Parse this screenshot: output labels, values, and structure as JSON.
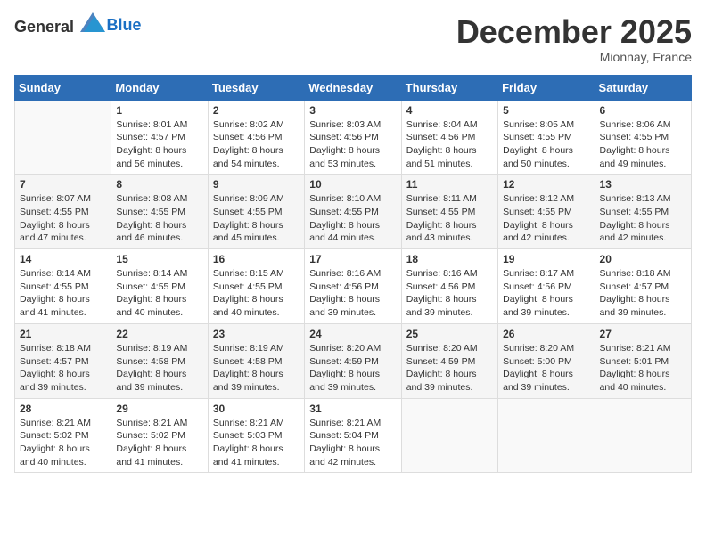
{
  "header": {
    "logo_general": "General",
    "logo_blue": "Blue",
    "month_year": "December 2025",
    "location": "Mionnay, France"
  },
  "days_of_week": [
    "Sunday",
    "Monday",
    "Tuesday",
    "Wednesday",
    "Thursday",
    "Friday",
    "Saturday"
  ],
  "weeks": [
    [
      {
        "day": null
      },
      {
        "day": 1,
        "sunrise": "8:01 AM",
        "sunset": "4:57 PM",
        "daylight": "8 hours and 56 minutes."
      },
      {
        "day": 2,
        "sunrise": "8:02 AM",
        "sunset": "4:56 PM",
        "daylight": "8 hours and 54 minutes."
      },
      {
        "day": 3,
        "sunrise": "8:03 AM",
        "sunset": "4:56 PM",
        "daylight": "8 hours and 53 minutes."
      },
      {
        "day": 4,
        "sunrise": "8:04 AM",
        "sunset": "4:56 PM",
        "daylight": "8 hours and 51 minutes."
      },
      {
        "day": 5,
        "sunrise": "8:05 AM",
        "sunset": "4:55 PM",
        "daylight": "8 hours and 50 minutes."
      },
      {
        "day": 6,
        "sunrise": "8:06 AM",
        "sunset": "4:55 PM",
        "daylight": "8 hours and 49 minutes."
      }
    ],
    [
      {
        "day": 7,
        "sunrise": "8:07 AM",
        "sunset": "4:55 PM",
        "daylight": "8 hours and 47 minutes."
      },
      {
        "day": 8,
        "sunrise": "8:08 AM",
        "sunset": "4:55 PM",
        "daylight": "8 hours and 46 minutes."
      },
      {
        "day": 9,
        "sunrise": "8:09 AM",
        "sunset": "4:55 PM",
        "daylight": "8 hours and 45 minutes."
      },
      {
        "day": 10,
        "sunrise": "8:10 AM",
        "sunset": "4:55 PM",
        "daylight": "8 hours and 44 minutes."
      },
      {
        "day": 11,
        "sunrise": "8:11 AM",
        "sunset": "4:55 PM",
        "daylight": "8 hours and 43 minutes."
      },
      {
        "day": 12,
        "sunrise": "8:12 AM",
        "sunset": "4:55 PM",
        "daylight": "8 hours and 42 minutes."
      },
      {
        "day": 13,
        "sunrise": "8:13 AM",
        "sunset": "4:55 PM",
        "daylight": "8 hours and 42 minutes."
      }
    ],
    [
      {
        "day": 14,
        "sunrise": "8:14 AM",
        "sunset": "4:55 PM",
        "daylight": "8 hours and 41 minutes."
      },
      {
        "day": 15,
        "sunrise": "8:14 AM",
        "sunset": "4:55 PM",
        "daylight": "8 hours and 40 minutes."
      },
      {
        "day": 16,
        "sunrise": "8:15 AM",
        "sunset": "4:55 PM",
        "daylight": "8 hours and 40 minutes."
      },
      {
        "day": 17,
        "sunrise": "8:16 AM",
        "sunset": "4:56 PM",
        "daylight": "8 hours and 39 minutes."
      },
      {
        "day": 18,
        "sunrise": "8:16 AM",
        "sunset": "4:56 PM",
        "daylight": "8 hours and 39 minutes."
      },
      {
        "day": 19,
        "sunrise": "8:17 AM",
        "sunset": "4:56 PM",
        "daylight": "8 hours and 39 minutes."
      },
      {
        "day": 20,
        "sunrise": "8:18 AM",
        "sunset": "4:57 PM",
        "daylight": "8 hours and 39 minutes."
      }
    ],
    [
      {
        "day": 21,
        "sunrise": "8:18 AM",
        "sunset": "4:57 PM",
        "daylight": "8 hours and 39 minutes."
      },
      {
        "day": 22,
        "sunrise": "8:19 AM",
        "sunset": "4:58 PM",
        "daylight": "8 hours and 39 minutes."
      },
      {
        "day": 23,
        "sunrise": "8:19 AM",
        "sunset": "4:58 PM",
        "daylight": "8 hours and 39 minutes."
      },
      {
        "day": 24,
        "sunrise": "8:20 AM",
        "sunset": "4:59 PM",
        "daylight": "8 hours and 39 minutes."
      },
      {
        "day": 25,
        "sunrise": "8:20 AM",
        "sunset": "4:59 PM",
        "daylight": "8 hours and 39 minutes."
      },
      {
        "day": 26,
        "sunrise": "8:20 AM",
        "sunset": "5:00 PM",
        "daylight": "8 hours and 39 minutes."
      },
      {
        "day": 27,
        "sunrise": "8:21 AM",
        "sunset": "5:01 PM",
        "daylight": "8 hours and 40 minutes."
      }
    ],
    [
      {
        "day": 28,
        "sunrise": "8:21 AM",
        "sunset": "5:02 PM",
        "daylight": "8 hours and 40 minutes."
      },
      {
        "day": 29,
        "sunrise": "8:21 AM",
        "sunset": "5:02 PM",
        "daylight": "8 hours and 41 minutes."
      },
      {
        "day": 30,
        "sunrise": "8:21 AM",
        "sunset": "5:03 PM",
        "daylight": "8 hours and 41 minutes."
      },
      {
        "day": 31,
        "sunrise": "8:21 AM",
        "sunset": "5:04 PM",
        "daylight": "8 hours and 42 minutes."
      },
      {
        "day": null
      },
      {
        "day": null
      },
      {
        "day": null
      }
    ]
  ],
  "labels": {
    "sunrise": "Sunrise:",
    "sunset": "Sunset:",
    "daylight": "Daylight: "
  }
}
